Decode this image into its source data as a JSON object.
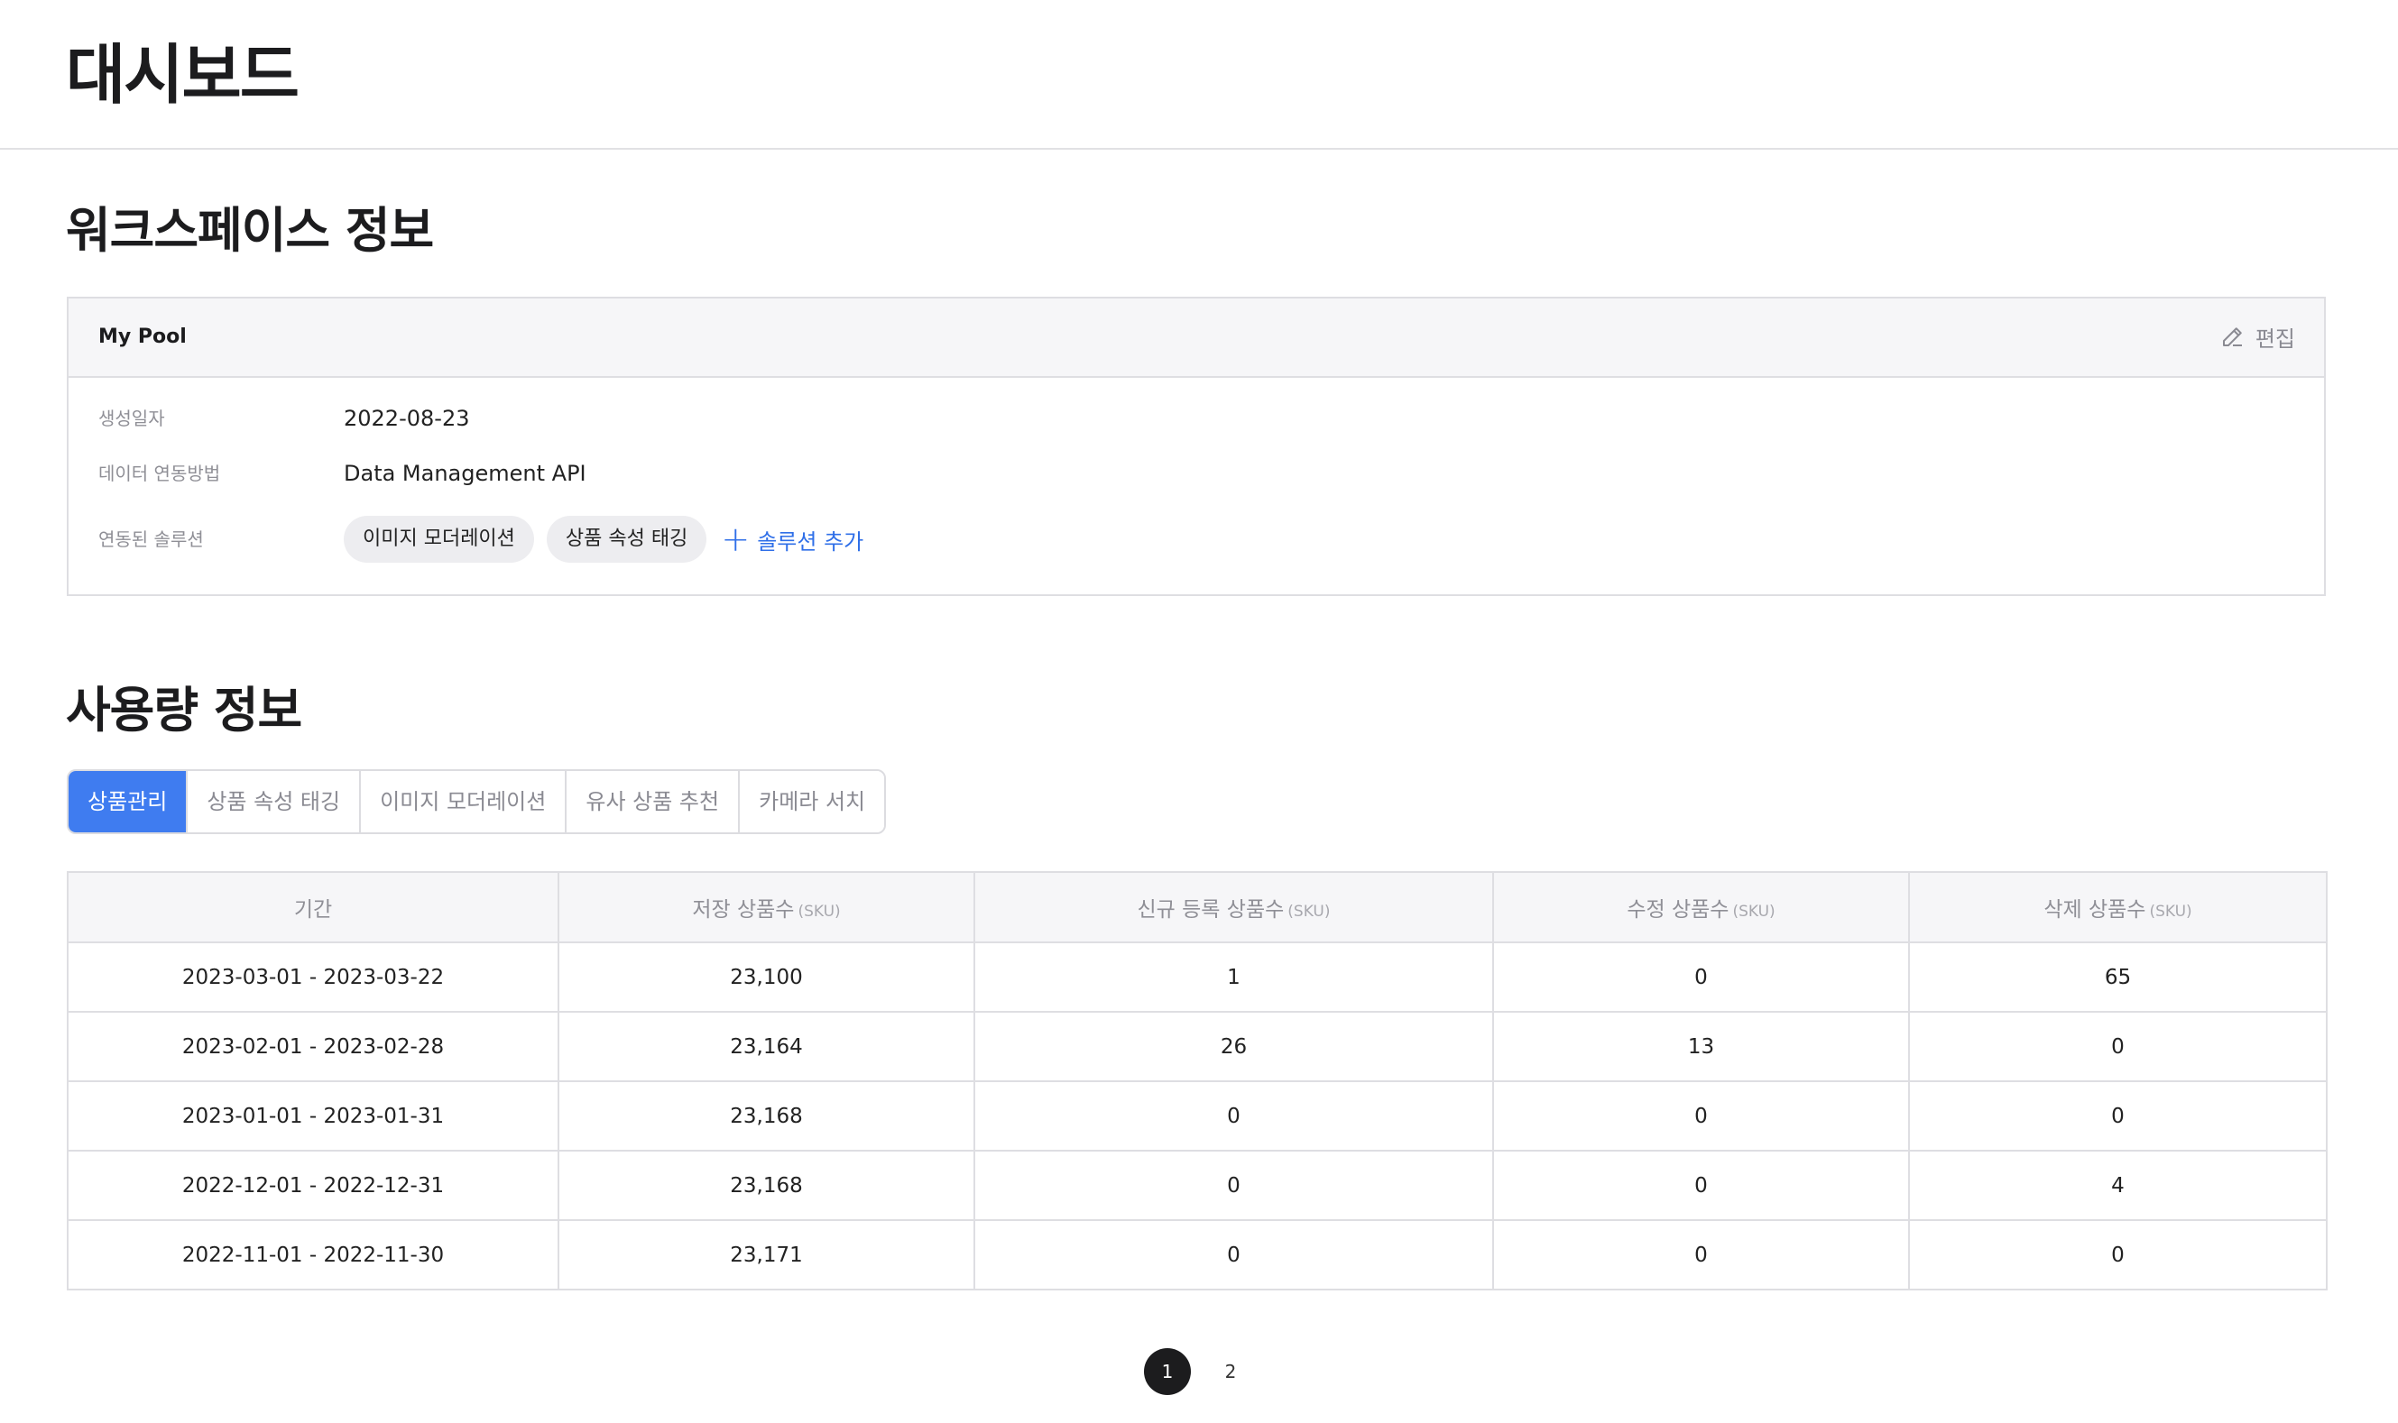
{
  "page": {
    "title": "대시보드"
  },
  "workspace": {
    "section_title": "워크스페이스 정보",
    "name": "My Pool",
    "edit_label": "편집",
    "created_label": "생성일자",
    "created_value": "2022-08-23",
    "integration_label": "데이터 연동방법",
    "integration_value": "Data Management API",
    "solutions_label": "연동된 솔루션",
    "solutions": [
      "이미지 모더레이션",
      "상품 속성 태깅"
    ],
    "add_solution_label": "솔루션 추가"
  },
  "usage": {
    "section_title": "사용량 정보",
    "tabs": [
      "상품관리",
      "상품 속성 태깅",
      "이미지 모더레이션",
      "유사 상품 추천",
      "카메라 서치"
    ],
    "active_tab": 0,
    "columns": [
      {
        "label": "기간",
        "unit": ""
      },
      {
        "label": "저장 상품수",
        "unit": "(SKU)"
      },
      {
        "label": "신규 등록 상품수",
        "unit": "(SKU)"
      },
      {
        "label": "수정 상품수",
        "unit": "(SKU)"
      },
      {
        "label": "삭제 상품수",
        "unit": "(SKU)"
      }
    ],
    "rows": [
      [
        "2023-03-01 - 2023-03-22",
        "23,100",
        "1",
        "0",
        "65"
      ],
      [
        "2023-02-01 - 2023-02-28",
        "23,164",
        "26",
        "13",
        "0"
      ],
      [
        "2023-01-01 - 2023-01-31",
        "23,168",
        "0",
        "0",
        "0"
      ],
      [
        "2022-12-01 - 2022-12-31",
        "23,168",
        "0",
        "0",
        "4"
      ],
      [
        "2022-11-01 - 2022-11-30",
        "23,171",
        "0",
        "0",
        "0"
      ]
    ]
  },
  "pagination": {
    "pages": [
      "1",
      "2"
    ],
    "current": 0
  },
  "colors": {
    "accent": "#3f7cf0",
    "link": "#2f6fe8",
    "active_page": "#1c1c1e"
  },
  "icons": {
    "edit": "pencil-icon",
    "add": "plus-icon"
  }
}
